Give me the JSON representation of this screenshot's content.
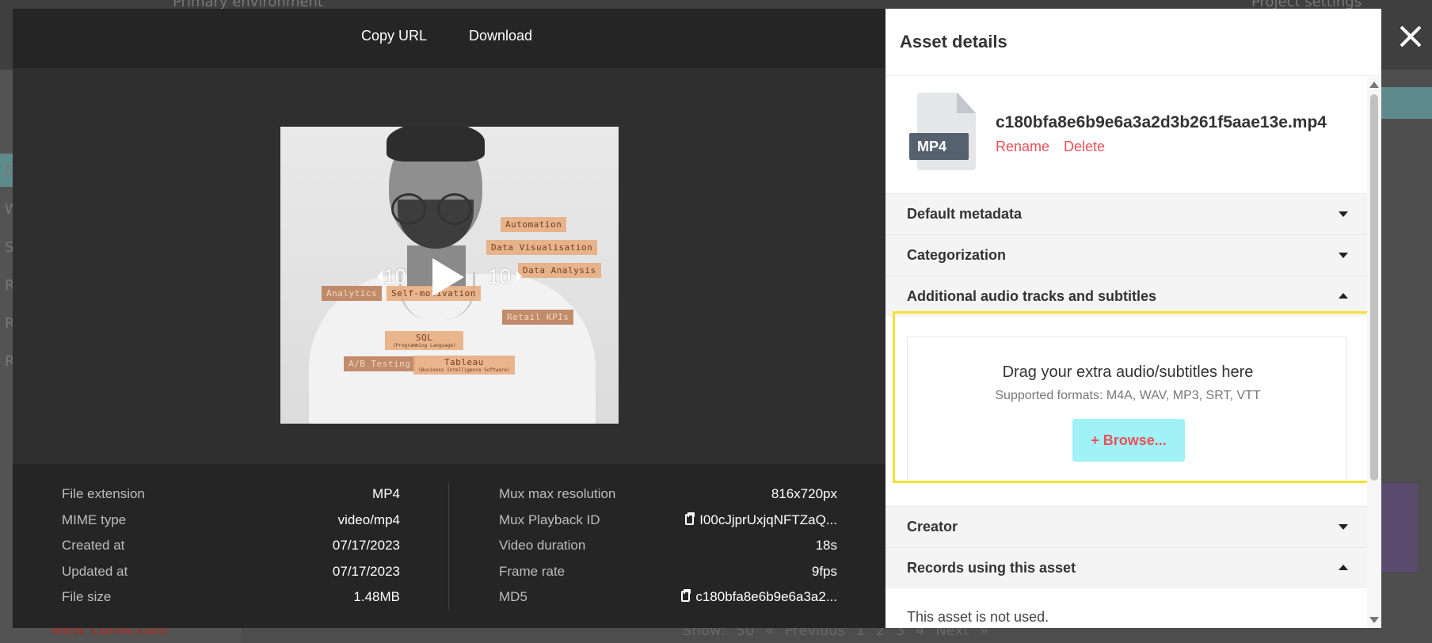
{
  "background": {
    "environment": "Primary environment",
    "project_settings": "Project settings",
    "new_collection": "New collection",
    "pagination": "Show: 50  « Previous  1  2  3  4  Next »"
  },
  "toolbar": {
    "copy_url": "Copy URL",
    "download": "Download"
  },
  "video": {
    "skip_back": "10",
    "skip_forward": "10",
    "tags": {
      "automation": "Automation",
      "data_visualisation": "Data Visualisation",
      "data_analysis": "Data Analysis",
      "analytics": "Analytics",
      "self_motivation": "Self-motivation",
      "retail_kpis": "Retail KPIs",
      "sql": "SQL",
      "sql_sub": "(Programming Language)",
      "ab_testing": "A/B Testing",
      "tableau": "Tableau",
      "tableau_sub": "(Business Intelligence Software)"
    }
  },
  "file_info": {
    "left": [
      {
        "label": "File extension",
        "value": "MP4"
      },
      {
        "label": "MIME type",
        "value": "video/mp4"
      },
      {
        "label": "Created at",
        "value": "07/17/2023"
      },
      {
        "label": "Updated at",
        "value": "07/17/2023"
      },
      {
        "label": "File size",
        "value": "1.48MB"
      }
    ],
    "right": [
      {
        "label": "Mux max resolution",
        "value": "816x720px"
      },
      {
        "label": "Mux Playback ID",
        "value": "I00cJjprUxjqNFTZaQ..."
      },
      {
        "label": "Video duration",
        "value": "18s"
      },
      {
        "label": "Frame rate",
        "value": "9fps"
      },
      {
        "label": "MD5",
        "value": "c180bfa8e6b9e6a3a2..."
      }
    ]
  },
  "panel": {
    "title": "Asset details",
    "file_type": "MP4",
    "file_name": "c180bfa8e6b9e6a3a2d3b261f5aae13e.mp4",
    "rename": "Rename",
    "delete": "Delete",
    "sections": {
      "default_metadata": "Default metadata",
      "categorization": "Categorization",
      "additional": "Additional audio tracks and subtitles",
      "creator": "Creator",
      "records": "Records using this asset"
    },
    "dropzone": {
      "title": "Drag your extra audio/subtitles here",
      "subtitle": "Supported formats: M4A, WAV, MP3, SRT, VTT",
      "browse": "+ Browse..."
    },
    "not_used": "This asset is not used."
  },
  "colors": {
    "accent_red": "#e8515b",
    "browse_bg": "#a1f2f7",
    "highlight_yellow": "#f3e136",
    "modal_dark": "#252525"
  }
}
